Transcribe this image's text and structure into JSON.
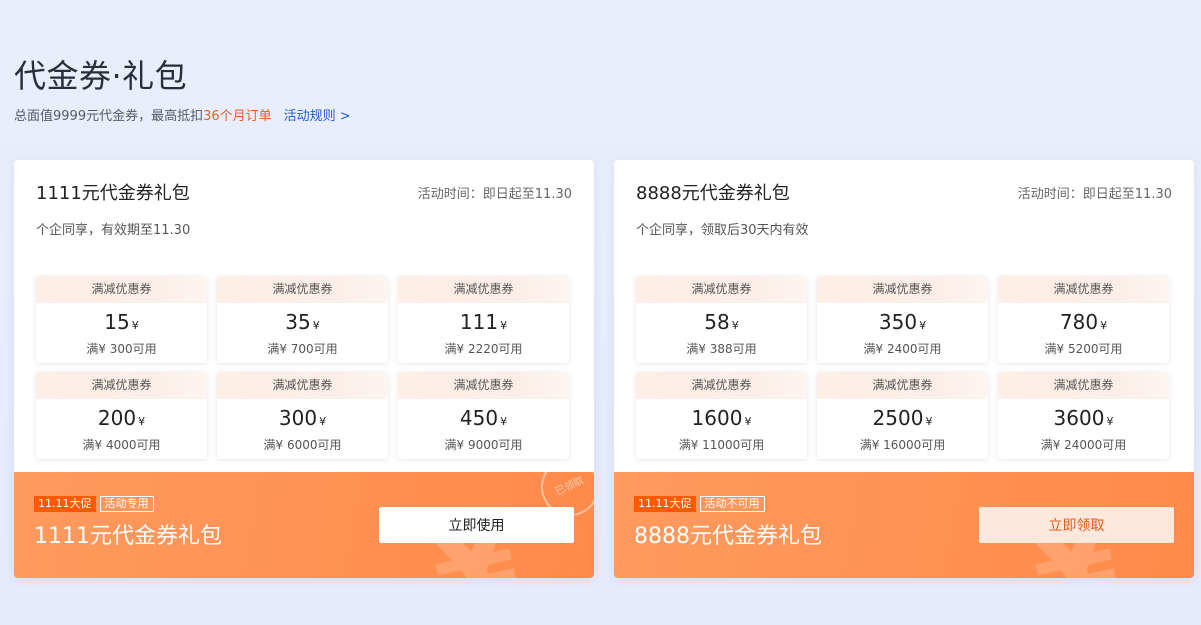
{
  "header": {
    "title": "代金券·礼包",
    "subtitle_prefix": "总面值9999元代金券，最高抵扣",
    "subtitle_highlight": "36个月订单",
    "rules_link": "活动规则 >"
  },
  "packages": [
    {
      "name": "1111元代金券礼包",
      "time": "活动时间：即日起至11.30",
      "desc": "个企同享，有效期至11.30",
      "coupons": [
        {
          "type": "满减优惠券",
          "amount": "15",
          "currency": "¥",
          "condition": "满¥ 300可用"
        },
        {
          "type": "满减优惠券",
          "amount": "35",
          "currency": "¥",
          "condition": "满¥ 700可用"
        },
        {
          "type": "满减优惠券",
          "amount": "111",
          "currency": "¥",
          "condition": "满¥ 2220可用"
        },
        {
          "type": "满减优惠券",
          "amount": "200",
          "currency": "¥",
          "condition": "满¥ 4000可用"
        },
        {
          "type": "满减优惠券",
          "amount": "300",
          "currency": "¥",
          "condition": "满¥ 6000可用"
        },
        {
          "type": "满减优惠券",
          "amount": "450",
          "currency": "¥",
          "condition": "满¥ 9000可用"
        }
      ],
      "promo_tag": "11.11大促",
      "type_tag": "活动专用",
      "footer_name": "1111元代金券礼包",
      "button_label": "立即使用",
      "stamp_text": "已领取"
    },
    {
      "name": "8888元代金券礼包",
      "time": "活动时间：即日起至11.30",
      "desc": "个企同享，领取后30天内有效",
      "coupons": [
        {
          "type": "满减优惠券",
          "amount": "58",
          "currency": "¥",
          "condition": "满¥ 388可用"
        },
        {
          "type": "满减优惠券",
          "amount": "350",
          "currency": "¥",
          "condition": "满¥ 2400可用"
        },
        {
          "type": "满减优惠券",
          "amount": "780",
          "currency": "¥",
          "condition": "满¥ 5200可用"
        },
        {
          "type": "满减优惠券",
          "amount": "1600",
          "currency": "¥",
          "condition": "满¥ 11000可用"
        },
        {
          "type": "满减优惠券",
          "amount": "2500",
          "currency": "¥",
          "condition": "满¥ 16000可用"
        },
        {
          "type": "满减优惠券",
          "amount": "3600",
          "currency": "¥",
          "condition": "满¥ 24000可用"
        }
      ],
      "promo_tag": "11.11大促",
      "type_tag": "活动不可用",
      "footer_name": "8888元代金券礼包",
      "button_label": "立即领取"
    }
  ],
  "colors": {
    "accent": "#f05a23",
    "link": "#1f5fd0",
    "footer_gradient_start": "#ff9a5e",
    "footer_gradient_end": "#ff8a4a"
  }
}
